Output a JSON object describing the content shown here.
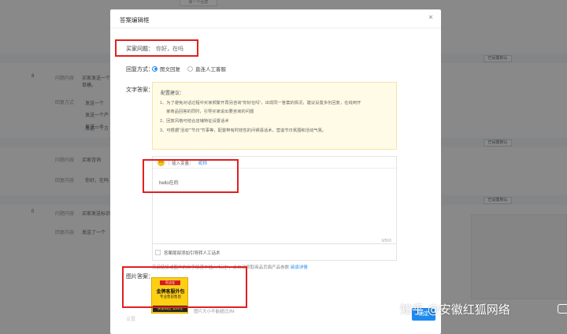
{
  "background": {
    "top_button": "第一个回复",
    "rows": [
      {
        "num": "8",
        "label": "问题内容",
        "text": "买家发送一个",
        "text2": "单模。"
      },
      {
        "label": "回复方式",
        "items": [
          "发送一个",
          "发送一个产",
          "发送一个",
          "发送一个方"
        ]
      },
      {
        "label": "问题内容",
        "text": "买家咨询"
      },
      {
        "label": "回复内容",
        "text": "你好，在吗"
      },
      {
        "num": "0",
        "label": "问题内容",
        "text": "买家发送标识"
      },
      {
        "label": "回复内容",
        "text": "发送了一个"
      }
    ],
    "tag_label": "已设置默认"
  },
  "modal": {
    "title": "答案编辑框",
    "close": "×",
    "question_label": "买家问题：",
    "question_value": "你好，在吗",
    "reply_mode_label": "回复方式：",
    "reply_mode_options": [
      {
        "label": "图文回复",
        "selected": true
      },
      {
        "label": "直连人工客服",
        "selected": false
      }
    ],
    "text_answer_label": "文字答案：",
    "tips": {
      "title": "配置建议：",
      "lines": [
        "1、为了避免对话过程中买家频繁开再另咨询“你好在吗”，出现同一答案的情况，建议设置多份回复，在线到开",
        "家商品回答的同时，引导买家说出要咨询的问题",
        "2、回复风格可结合店铺特征设置话术",
        "3、可根据“活动”“节日”节事等，配置带有时效性的问候语话术，营造节日氛围和活动气氛。"
      ]
    },
    "editor": {
      "var_label": "插入变量：",
      "var_link": "昵称",
      "content": "hello在的",
      "counter": "6/500",
      "checkbox_label": "答案尾部添加引导转人工话术"
    },
    "hint": {
      "text": "商品链接或图片的文字段落中插入“标注”，会自动抓取商品页面产品参数",
      "link": "阅读详情"
    },
    "picture_label": "图片答案：",
    "picture_note": "图片大小不能超过2M",
    "picture": {
      "top": "旺店宝",
      "main": "金牌客服外包",
      "sub": "专业售前售后",
      "bottom": "快速响应 高转化"
    },
    "confirm": "确定",
    "faded_label": "设置"
  },
  "watermark": "知乎 @安徽红狐网络",
  "colors": {
    "accent": "#1e8bf0",
    "highlight_box": "#e02020",
    "tips_bg": "#fffbe6"
  }
}
